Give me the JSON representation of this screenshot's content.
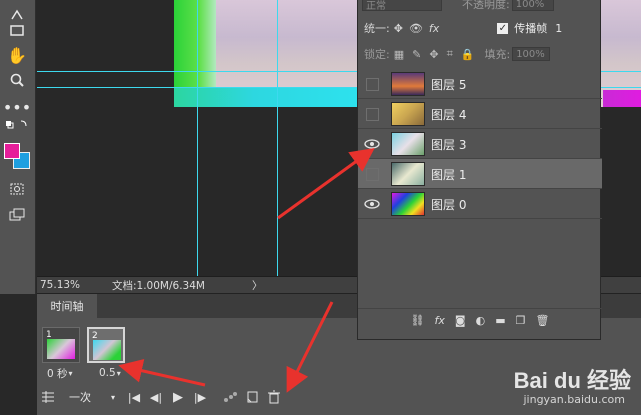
{
  "status_bar": {
    "zoom": "75.13%",
    "doc_info": "文档:1.00M/6.34M",
    "arrow": "〉"
  },
  "timeline": {
    "tab_label": "时间轴",
    "frames": [
      {
        "number": "1",
        "delay": "0 秒",
        "selected": false
      },
      {
        "number": "2",
        "delay": "0.5",
        "selected": true
      }
    ],
    "loop_value": "一次"
  },
  "layers_panel": {
    "blend_mode": "正常",
    "opacity_label": "不透明度:",
    "opacity_value": "100%",
    "unify_label": "统一:",
    "propagate_label": "传播帧",
    "propagate_value": "1",
    "propagate_checked": true,
    "lock_label": "锁定:",
    "fill_label": "填充:",
    "fill_value": "100%",
    "layers": [
      {
        "name": "图层 5",
        "visible": false,
        "selected": false
      },
      {
        "name": "图层 4",
        "visible": false,
        "selected": false
      },
      {
        "name": "图层 3",
        "visible": true,
        "selected": false
      },
      {
        "name": "图层 1",
        "visible": false,
        "selected": true
      },
      {
        "name": "图层 0",
        "visible": true,
        "selected": false
      }
    ]
  },
  "watermark": {
    "brand": "Bai du 经验",
    "url": "jingyan.baidu.com"
  },
  "colors": {
    "foreground": "#e61e9a",
    "background": "#1e9fe0",
    "guide": "#3dd9ee",
    "arrow": "#e8322d"
  }
}
